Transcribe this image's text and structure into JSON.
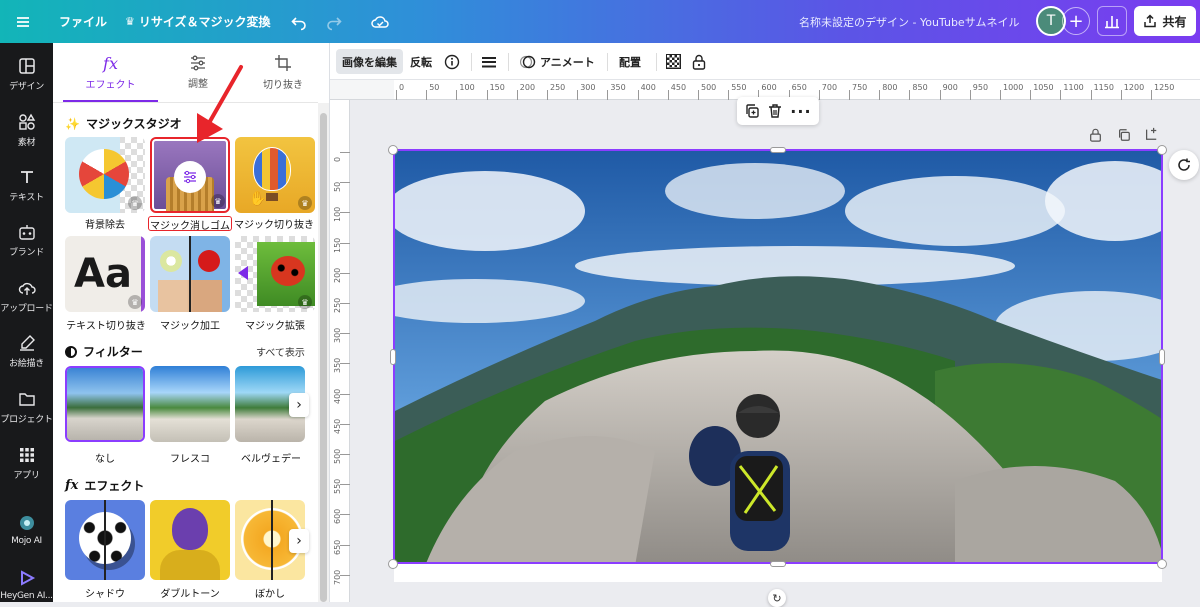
{
  "topbar": {
    "menu_icon": "hamburger-icon",
    "file_label": "ファイル",
    "resize_label": "リサイズ＆マジック変換",
    "doc_title": "名称未設定のデザイン - YouTubeサムネイル",
    "avatar_initial": "T",
    "share_label": "共有"
  },
  "rail": {
    "items": [
      {
        "label": "デザイン",
        "icon": "layout-icon"
      },
      {
        "label": "素材",
        "icon": "shapes-icon"
      },
      {
        "label": "テキスト",
        "icon": "text-icon"
      },
      {
        "label": "ブランド",
        "icon": "brand-icon"
      },
      {
        "label": "アップロード",
        "icon": "upload-cloud-icon"
      },
      {
        "label": "お絵描き",
        "icon": "draw-icon"
      },
      {
        "label": "プロジェクト",
        "icon": "folder-icon"
      },
      {
        "label": "アプリ",
        "icon": "apps-grid-icon"
      },
      {
        "label": "Mojo AI",
        "icon": "mojo-ai-icon"
      },
      {
        "label": "HeyGen AI...",
        "icon": "heygen-icon"
      }
    ]
  },
  "panel": {
    "tabs": [
      {
        "label": "エフェクト",
        "icon": "fx-icon"
      },
      {
        "label": "調整",
        "icon": "sliders-icon"
      },
      {
        "label": "切り抜き",
        "icon": "crop-icon"
      }
    ],
    "magic_studio": {
      "title": "マジックスタジオ",
      "items": [
        "背景除去",
        "マジック消しゴム",
        "マジック切り抜き",
        "テキスト切り抜き",
        "マジック加工",
        "マジック拡張"
      ]
    },
    "filters": {
      "title": "フィルター",
      "see_all": "すべて表示",
      "items": [
        "なし",
        "フレスコ",
        "ベルヴェデー"
      ]
    },
    "effects": {
      "title": "エフェクト",
      "items": [
        "シャドウ",
        "ダブルトーン",
        "ぼかし"
      ]
    }
  },
  "toolbar": {
    "edit_image": "画像を編集",
    "flip": "反転",
    "animate": "アニメート",
    "position": "配置"
  },
  "ruler": {
    "h_ticks": [
      "0",
      "50",
      "100",
      "150",
      "200",
      "250",
      "300",
      "350",
      "400",
      "450",
      "500",
      "550",
      "600",
      "650",
      "700",
      "750",
      "800",
      "850",
      "900",
      "950",
      "1000",
      "1050",
      "1100",
      "1150",
      "1200",
      "1250"
    ],
    "v_ticks": [
      "0",
      "50",
      "100",
      "150",
      "200",
      "250",
      "300",
      "350",
      "400",
      "450",
      "500",
      "550",
      "600",
      "650",
      "700"
    ]
  },
  "colors": {
    "accent": "#7d2ae8",
    "selection": "#8b3dff",
    "arrow": "#e8252b"
  }
}
